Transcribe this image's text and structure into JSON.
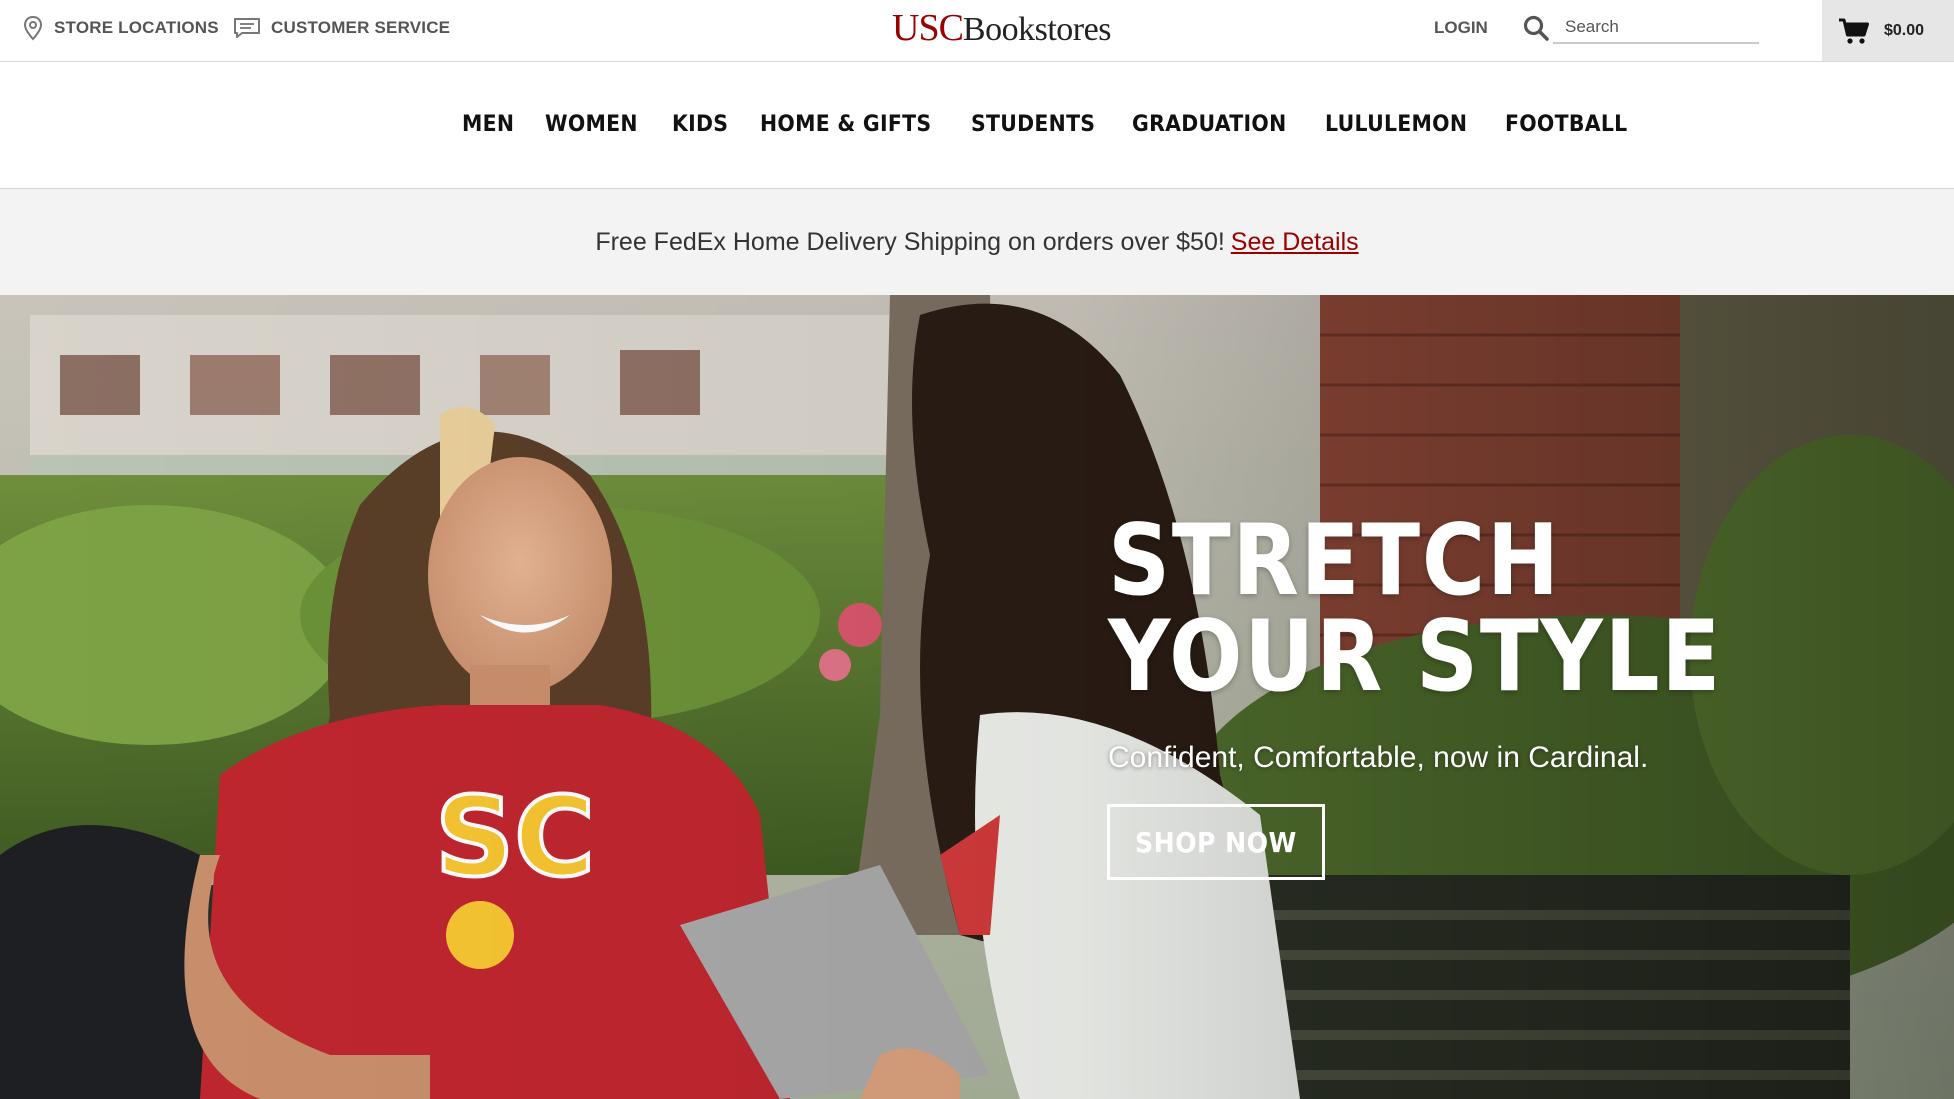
{
  "header": {
    "store_locations": "STORE LOCATIONS",
    "customer_service": "CUSTOMER SERVICE",
    "logo_usc": "USC",
    "logo_bookstores": "Bookstores",
    "login": "LOGIN",
    "search_placeholder": "Search",
    "cart_total": "$0.00"
  },
  "nav": {
    "items": [
      {
        "label": "MEN"
      },
      {
        "label": "WOMEN"
      },
      {
        "label": "KIDS"
      },
      {
        "label": "HOME & GIFTS"
      },
      {
        "label": "STUDENTS"
      },
      {
        "label": "GRADUATION"
      },
      {
        "label": "LULULEMON"
      },
      {
        "label": "FOOTBALL"
      }
    ]
  },
  "promo": {
    "message": "Free FedEx Home Delivery Shipping on orders over $50!",
    "link": "See Details"
  },
  "hero": {
    "title_line1": "STRETCH",
    "title_line2": "YOUR STYLE",
    "subtitle": "Confident, Comfortable, now in Cardinal.",
    "cta": "SHOP NOW"
  },
  "colors": {
    "cardinal": "#990000",
    "gold": "#FFCC00",
    "cart_bg": "#e6e6e6",
    "promo_bg": "#f3f3f3"
  },
  "icons": {
    "store": "map-pin-icon",
    "service": "chat-icon",
    "search": "search-icon",
    "cart": "cart-icon"
  }
}
